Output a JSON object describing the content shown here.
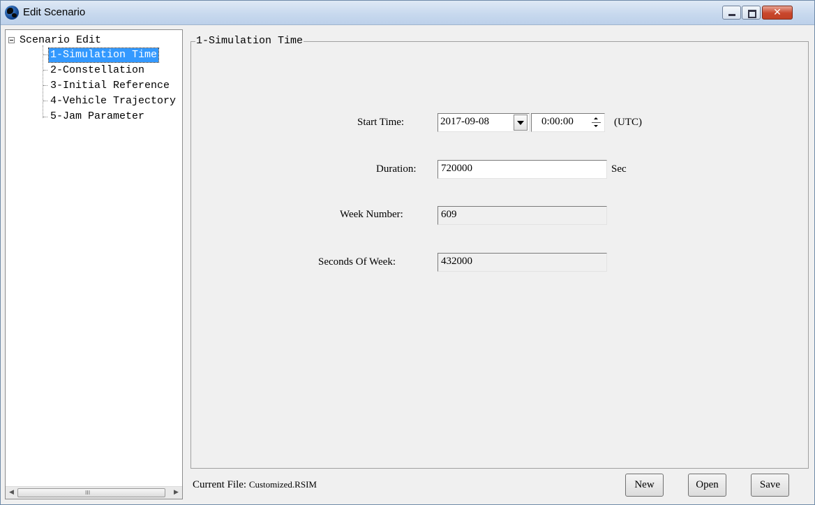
{
  "window": {
    "title": "Edit Scenario",
    "close_symbol": "✕",
    "icon": "globe-icon"
  },
  "tree": {
    "root_label": "Scenario Edit",
    "items": [
      {
        "label": "1-Simulation Time",
        "selected": true
      },
      {
        "label": "2-Constellation",
        "selected": false
      },
      {
        "label": "3-Initial Reference",
        "selected": false
      },
      {
        "label": "4-Vehicle Trajectory",
        "selected": false
      },
      {
        "label": "5-Jam Parameter",
        "selected": false
      }
    ],
    "scroll_left": "◀",
    "scroll_right": "▶",
    "scroll_grip": "III"
  },
  "panel": {
    "legend": "1-Simulation Time",
    "start_time": {
      "label": "Start Time:",
      "date": "2017-09-08",
      "time": "0:00:00",
      "zone": "(UTC)"
    },
    "duration": {
      "label": "Duration:",
      "value": "720000",
      "unit": "Sec"
    },
    "week_number": {
      "label": "Week Number:",
      "value": "609"
    },
    "seconds_of_week": {
      "label": "Seconds Of Week:",
      "value": "432000"
    }
  },
  "footer": {
    "current_file_label": "Current File:",
    "current_file_value": "Customized.RSIM",
    "buttons": {
      "new": "New",
      "open": "Open",
      "save": "Save"
    }
  }
}
